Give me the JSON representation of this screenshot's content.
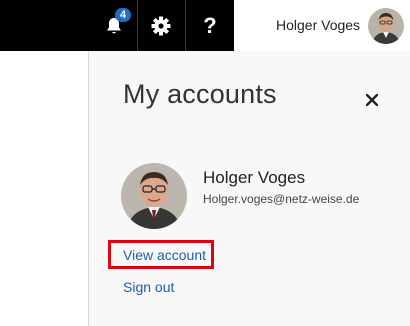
{
  "header": {
    "notifications": {
      "count": "4",
      "icon": "bell-icon"
    },
    "settings": {
      "icon": "gear-icon"
    },
    "help": {
      "label": "?",
      "icon": "help-icon"
    },
    "user_name": "Holger Voges"
  },
  "panel": {
    "title": "My accounts",
    "close_label": "×",
    "account": {
      "name": "Holger Voges",
      "email": "Holger.voges@netz-weise.de"
    },
    "view_account_label": "View account",
    "sign_out_label": "Sign out"
  },
  "colors": {
    "header_black": "#000000",
    "badge": "#1f6fc5",
    "link": "#1a5fb4",
    "highlight": "#e0000f",
    "panel_bg": "#f8f8f8"
  }
}
